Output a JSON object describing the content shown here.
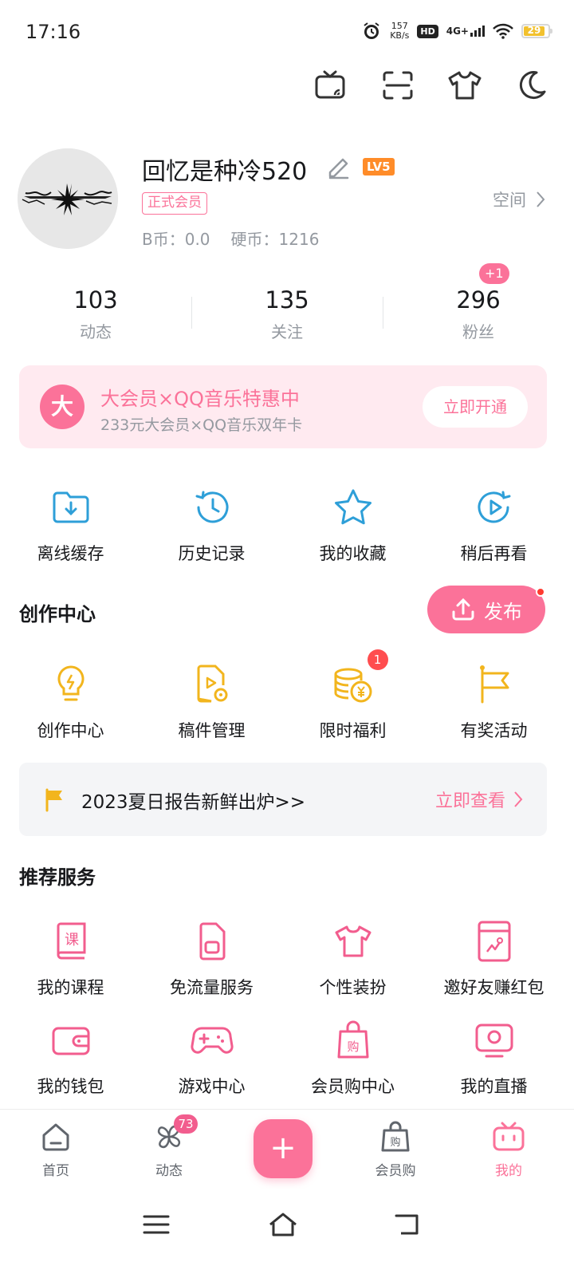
{
  "status_bar": {
    "time": "17:16",
    "speed_value": "157",
    "speed_unit": "KB/s",
    "hd": "HD",
    "network": "4G+",
    "battery": "29"
  },
  "top_tools": [
    "tv-cast-icon",
    "scan-icon",
    "tshirt-icon",
    "moon-icon"
  ],
  "profile": {
    "username": "回忆是种冷520",
    "level": "LV5",
    "vip_tag": "正式会员",
    "bcoin": "B币：0.0",
    "coins": "硬币：1216",
    "space_link": "空间"
  },
  "stats": [
    {
      "value": "103",
      "label": "动态"
    },
    {
      "value": "135",
      "label": "关注"
    },
    {
      "value": "296",
      "label": "粉丝"
    }
  ],
  "fans_badge": "+1",
  "vip_banner": {
    "icon_char": "大",
    "title": "大会员×QQ音乐特惠中",
    "subtitle": "233元大会员×QQ音乐双年卡",
    "button": "立即开通"
  },
  "quick_actions": [
    {
      "label": "离线缓存",
      "icon": "download-folder-icon"
    },
    {
      "label": "历史记录",
      "icon": "history-icon"
    },
    {
      "label": "我的收藏",
      "icon": "star-icon"
    },
    {
      "label": "稍后再看",
      "icon": "watch-later-icon"
    }
  ],
  "creation": {
    "title": "创作中心",
    "publish": "发布",
    "items": [
      {
        "label": "创作中心",
        "icon": "lightbulb-icon"
      },
      {
        "label": "稿件管理",
        "icon": "manuscript-icon"
      },
      {
        "label": "限时福利",
        "icon": "coins-icon",
        "badge": "1"
      },
      {
        "label": "有奖活动",
        "icon": "flag-icon"
      }
    ]
  },
  "report": {
    "text": "2023夏日报告新鲜出炉>>",
    "link": "立即查看"
  },
  "services": {
    "title": "推荐服务",
    "row1": [
      {
        "label": "我的课程",
        "icon": "course-icon"
      },
      {
        "label": "免流量服务",
        "icon": "sim-card-icon"
      },
      {
        "label": "个性装扮",
        "icon": "tshirt-icon"
      },
      {
        "label": "邀好友赚红包",
        "icon": "red-packet-icon"
      }
    ],
    "row2": [
      {
        "label": "我的钱包",
        "icon": "wallet-icon"
      },
      {
        "label": "游戏中心",
        "icon": "gamepad-icon"
      },
      {
        "label": "会员购中心",
        "icon": "shopping-bag-icon"
      },
      {
        "label": "我的直播",
        "icon": "live-tv-icon"
      }
    ]
  },
  "bottom_nav": {
    "home": "首页",
    "dynamic": "动态",
    "dynamic_badge": "73",
    "plus": "+",
    "shop": "会员购",
    "mine": "我的"
  },
  "colors": {
    "accent": "#fb7299",
    "blue_icon": "#2e9fd8",
    "yellow_icon": "#f2b51d"
  }
}
